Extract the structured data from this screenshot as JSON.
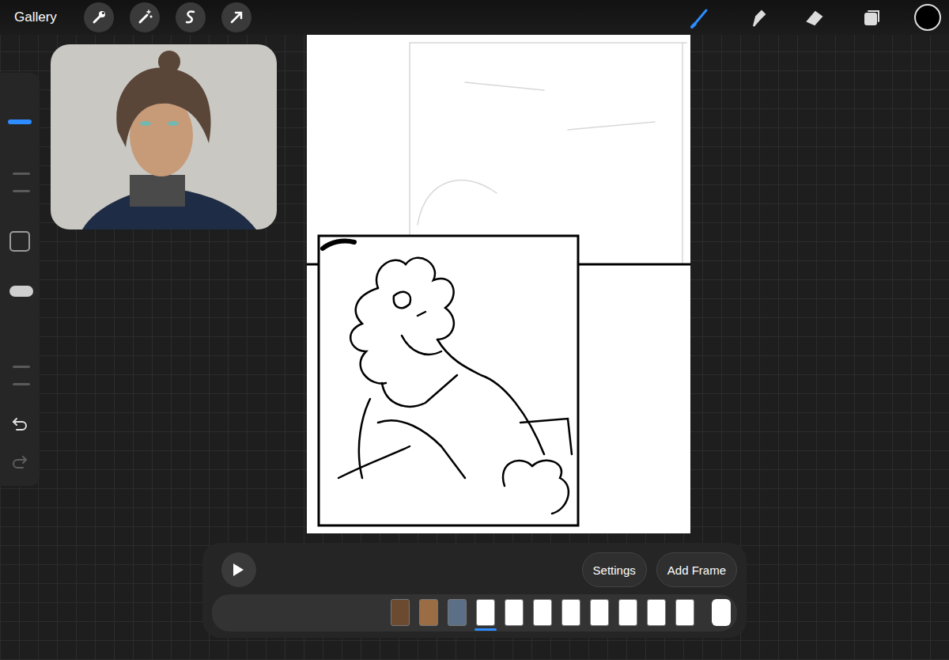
{
  "topbar": {
    "gallery": "Gallery",
    "actions": [
      {
        "kind": "wrench"
      },
      {
        "kind": "wand"
      },
      {
        "kind": "selection"
      },
      {
        "kind": "transform"
      }
    ],
    "tools": [
      {
        "kind": "brush",
        "selected": true
      },
      {
        "kind": "smudge",
        "selected": false
      },
      {
        "kind": "eraser",
        "selected": false
      },
      {
        "kind": "layers",
        "selected": false
      }
    ],
    "color": "#000000"
  },
  "sidebar": {
    "size": {
      "level": 0.69
    },
    "opacity": {
      "level": 0.9
    },
    "undo": {
      "disabled": false
    },
    "redo": {
      "disabled": true
    }
  },
  "animation": {
    "playing": false,
    "buttons": [
      "Settings",
      "Add Frame"
    ],
    "frames": [
      {
        "color": "#6b4a30",
        "selected": false
      },
      {
        "color": "#9a6d45",
        "selected": false
      },
      {
        "color": "#5b6f86",
        "selected": false
      },
      {
        "color": "#ffffff",
        "selected": true
      },
      {
        "color": "#ffffff",
        "selected": false
      },
      {
        "color": "#ffffff",
        "selected": false
      },
      {
        "color": "#ffffff",
        "selected": false
      },
      {
        "color": "#ffffff",
        "selected": false
      },
      {
        "color": "#ffffff",
        "selected": false
      },
      {
        "color": "#ffffff",
        "selected": false
      },
      {
        "color": "#ffffff",
        "selected": false
      }
    ]
  }
}
